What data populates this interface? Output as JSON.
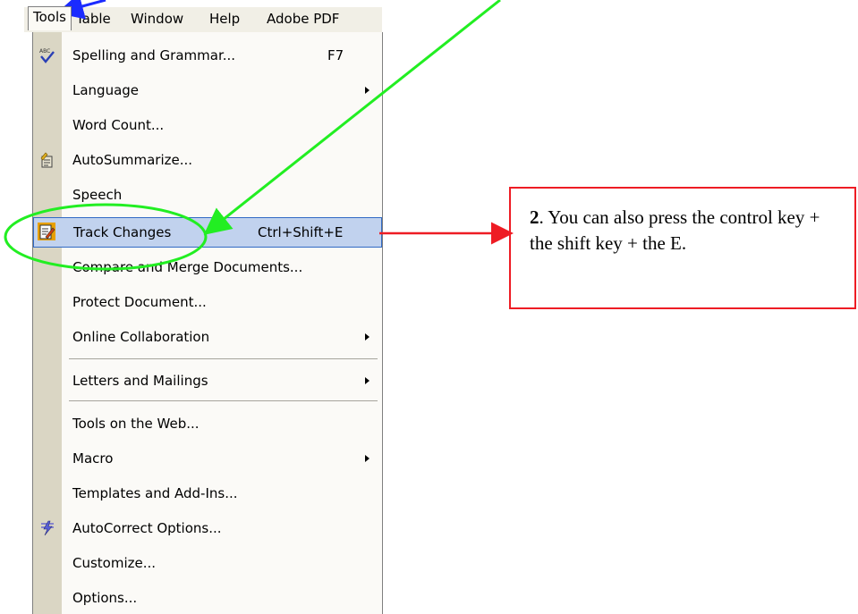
{
  "menubar": {
    "items": [
      "Tools",
      "Table",
      "Window",
      "Help",
      "Adobe PDF"
    ]
  },
  "menu": {
    "items": [
      {
        "label": "Spelling and Grammar...",
        "shortcut": "F7",
        "icon": "spelling-abc-check-icon"
      },
      {
        "label": "Language",
        "submenu": true
      },
      {
        "label": "Word Count..."
      },
      {
        "label": "AutoSummarize...",
        "icon": "autosummarize-icon"
      },
      {
        "label": "Speech"
      },
      {
        "label": "Track Changes",
        "shortcut": "Ctrl+Shift+E",
        "icon": "track-changes-icon",
        "highlighted": true
      },
      {
        "label": "Compare and Merge Documents..."
      },
      {
        "label": "Protect Document..."
      },
      {
        "label": "Online Collaboration",
        "submenu": true
      },
      {
        "label": "Letters and Mailings",
        "submenu": true
      },
      {
        "label": "Tools on the Web..."
      },
      {
        "label": "Macro",
        "submenu": true
      },
      {
        "label": "Templates and Add-Ins..."
      },
      {
        "label": "AutoCorrect Options...",
        "icon": "autocorrect-lightning-icon"
      },
      {
        "label": "Customize..."
      },
      {
        "label": "Options..."
      }
    ]
  },
  "callout": {
    "number": "2",
    "text": ". You can also press the control key + the shift key + the E."
  },
  "colors": {
    "callout_border": "#ee1c24",
    "arrow_red": "#ee1c24",
    "arrow_green": "#22ee22",
    "arrow_blue": "#1b2bff",
    "highlight_bg": "#c1d2ee",
    "highlight_border": "#316ac5"
  }
}
